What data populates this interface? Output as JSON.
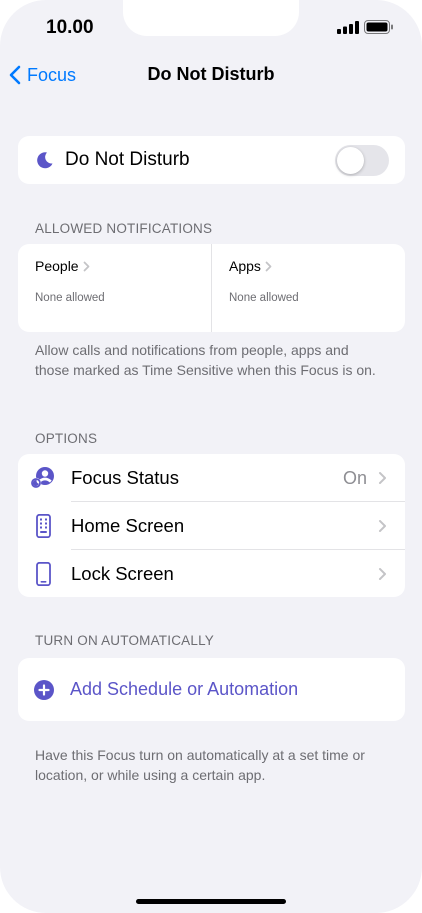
{
  "status_bar": {
    "time": "10.00"
  },
  "nav": {
    "back_label": "Focus",
    "title": "Do Not Disturb"
  },
  "dnd": {
    "label": "Do Not Disturb",
    "enabled": false
  },
  "allowed_notifications": {
    "header": "ALLOWED NOTIFICATIONS",
    "people": {
      "title": "People",
      "subtitle": "None allowed"
    },
    "apps": {
      "title": "Apps",
      "subtitle": "None allowed"
    },
    "footnote": "Allow calls and notifications from people, apps and those marked as Time Sensitive when this Focus is on."
  },
  "options": {
    "header": "OPTIONS",
    "items": [
      {
        "label": "Focus Status",
        "value": "On",
        "icon": "focus-status-icon"
      },
      {
        "label": "Home Screen",
        "value": "",
        "icon": "home-screen-icon"
      },
      {
        "label": "Lock Screen",
        "value": "",
        "icon": "lock-screen-icon"
      }
    ]
  },
  "automation": {
    "header": "TURN ON AUTOMATICALLY",
    "add_label": "Add Schedule or Automation",
    "footnote": "Have this Focus turn on automatically at a set time or location, or while using a certain app."
  },
  "colors": {
    "accent": "#5b55c8",
    "link": "#007aff",
    "background": "#f2f2f7"
  }
}
